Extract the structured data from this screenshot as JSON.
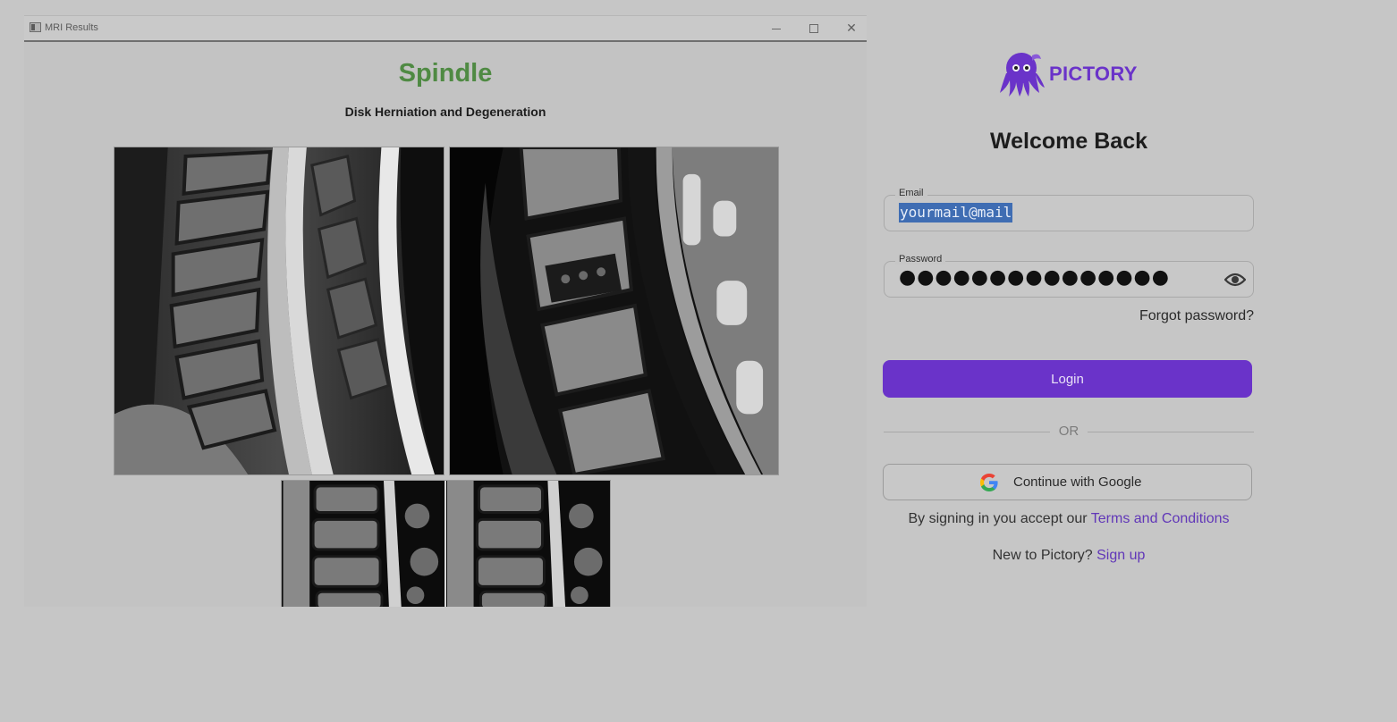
{
  "window": {
    "title": "MRI Results",
    "controls": {
      "minimize": "–",
      "close": "✕"
    }
  },
  "mri": {
    "title": "Spindle",
    "subtitle": "Disk Herniation and Degeneration"
  },
  "login": {
    "brand": "PICTORY",
    "heading": "Welcome Back",
    "email": {
      "label": "Email",
      "value": "yourmail@mail"
    },
    "password": {
      "label": "Password",
      "value": "●●●●●●●●●●●●●●●"
    },
    "forgot": "Forgot password?",
    "login_button": "Login",
    "divider": "OR",
    "google_button": "Continue with Google",
    "terms_prefix": "By signing in you accept our ",
    "terms_link": "Terms and Conditions",
    "signup_prefix": "New to Pictory? ",
    "signup_link": "Sign up"
  },
  "colors": {
    "brand_purple": "#6a33c9",
    "title_green": "#4f8a43",
    "link_purple": "#6137b8"
  },
  "icons": {
    "app": "app-window-icon",
    "eye": "eye-icon",
    "google": "google-icon",
    "logo": "octopus-logo-icon"
  }
}
